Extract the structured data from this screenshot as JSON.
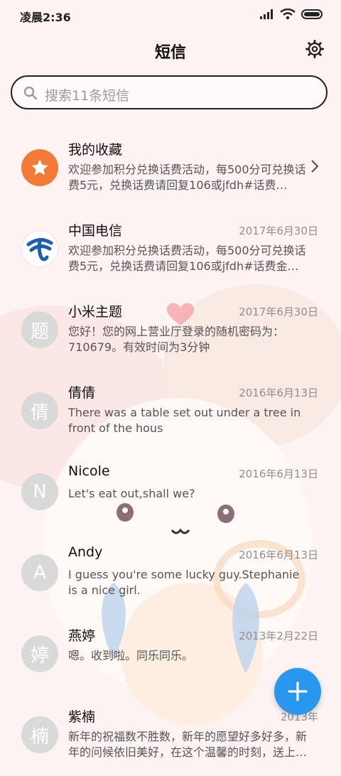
{
  "status_bar": {
    "time": "凌晨2:36"
  },
  "header": {
    "title": "短信"
  },
  "search": {
    "placeholder": "搜索11条短信"
  },
  "conversations": [
    {
      "name": "我的收藏",
      "date": "",
      "preview": "欢迎参加积分兑换话费活动，每500分可兑换话费5元，兑换话费请回复106或jfdh#话费…",
      "avatar": "",
      "avatar_icon": "star-icon"
    },
    {
      "name": "中国电信",
      "date": "2017年6月30日",
      "preview": "欢迎参加积分兑换话费活动，每500分可兑换话费5元，兑换话费请回复106或jfdh#话费金…",
      "avatar": "",
      "avatar_icon": "china-telecom-logo"
    },
    {
      "name": "小米主题",
      "date": "2017年6月30日",
      "preview": "您好！您的网上营业厅登录的随机密码为：710679。有效时间为3分钟",
      "avatar": "题"
    },
    {
      "name": "倩倩",
      "date": "2016年6月13日",
      "preview": "There was a table set out under a tree in front of the hous",
      "avatar": "倩"
    },
    {
      "name": "Nicole",
      "date": "2016年6月13日",
      "preview": "Let's eat out,shall we?",
      "avatar": "N"
    },
    {
      "name": "Andy",
      "date": "2016年6月13日",
      "preview": "I guess you're some lucky guy.Stephanie is a nice girl.",
      "avatar": "A"
    },
    {
      "name": "燕婷",
      "date": "2013年2月22日",
      "preview": "嗯。收到啦。同乐同乐。",
      "avatar": "婷"
    },
    {
      "name": "紫楠",
      "date": "2013年",
      "preview": "新年的祝福数不胜数，新年的愿望好多好多，新年的问候依旧美好，在这个温馨的时刻，送上…",
      "avatar": "楠"
    }
  ],
  "colors": {
    "fab": "#2a97ee",
    "favorite_avatar": "#f27a36",
    "avatar_default": "#d9d9d9"
  }
}
